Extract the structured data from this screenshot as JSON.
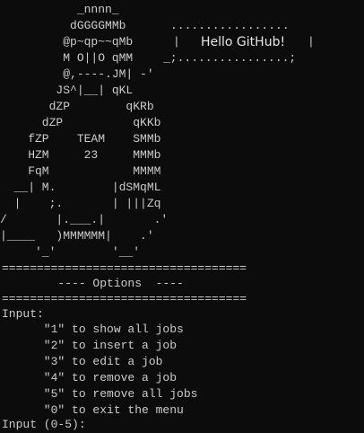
{
  "ascii_art": [
    "           _nnnn_",
    "          dGGGGMMb",
    "         @p~qp~~qMb",
    "         M O||O qMM",
    "         @,----.JM| -'",
    "        JS^|__| qKL",
    "       dZP        qKRb",
    "      dZP          qKKb",
    "    fZP    TEAM    SMMb",
    "    HZM     23     MMMb",
    "    FqM            MMMM",
    "  __| M.        |dSMqML",
    "  |    ;.       | |||Zq",
    "/       |.___.|       .'",
    "|____   )MMMMMM|    .'",
    "     '_'        '__'"
  ],
  "bubble": {
    "top_border": ".................",
    "left_edge": "|",
    "right_edge": "|",
    "bottom_border": "_;................;",
    "message": "Hello GitHub!"
  },
  "menu": {
    "separator_top": "===================================",
    "title": "        ---- Options  ----",
    "separator_bottom": "===================================",
    "input_label": "Input:",
    "options": [
      "      \"1\" to show all jobs",
      "      \"2\" to insert a job",
      "      \"3\" to edit a job",
      "      \"4\" to remove a job",
      "      \"5\" to remove all jobs",
      "      \"0\" to exit the menu"
    ],
    "prompt": "Input (0-5):"
  }
}
